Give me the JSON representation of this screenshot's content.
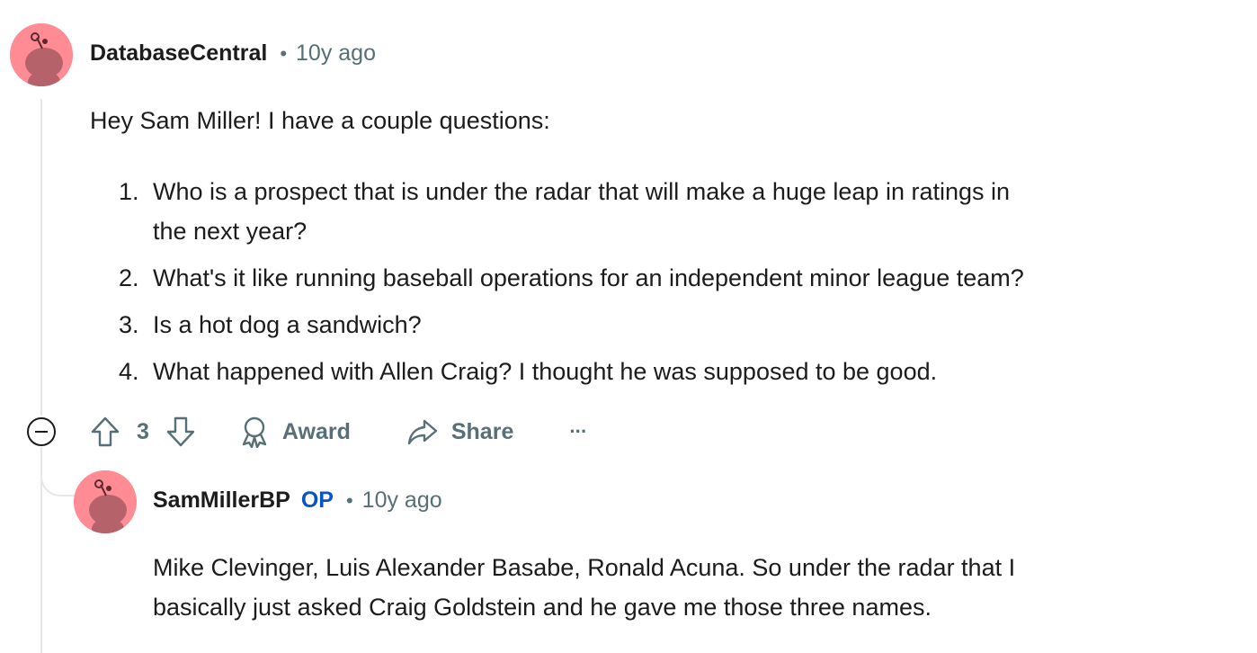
{
  "comment": {
    "username": "DatabaseCentral",
    "separator": "•",
    "age": "10y ago",
    "intro": "Hey Sam Miller! I have a couple questions:",
    "questions": [
      {
        "num": "1.",
        "line1": "Who is a prospect that is under the radar that will make a huge leap in ratings in",
        "line2": "the next year?"
      },
      {
        "num": "2.",
        "line1": "What's it like running baseball operations for an independent minor league team?"
      },
      {
        "num": "3.",
        "line1": "Is a hot dog a sandwich?"
      },
      {
        "num": "4.",
        "line1": "What happened with Allen Craig? I thought he was supposed to be good."
      }
    ],
    "score": "3",
    "award_label": "Award",
    "share_label": "Share",
    "more_label": "···"
  },
  "reply": {
    "username": "SamMillerBP",
    "op_badge": "OP",
    "separator": "•",
    "age": "10y ago",
    "line1": "Mike Clevinger, Luis Alexander Basabe, Ronald Acuna. So under the radar that I",
    "line2": "basically just asked Craig Goldstein and he gave me those three names."
  },
  "colors": {
    "avatar_bg": "#ff8c94",
    "op_blue": "#0a53c4",
    "muted": "#576f76",
    "thread_line": "#e5e7ea"
  },
  "icons": [
    "snoo-avatar-icon",
    "collapse-icon",
    "upvote-icon",
    "downvote-icon",
    "award-icon",
    "share-icon",
    "more-options-icon"
  ]
}
